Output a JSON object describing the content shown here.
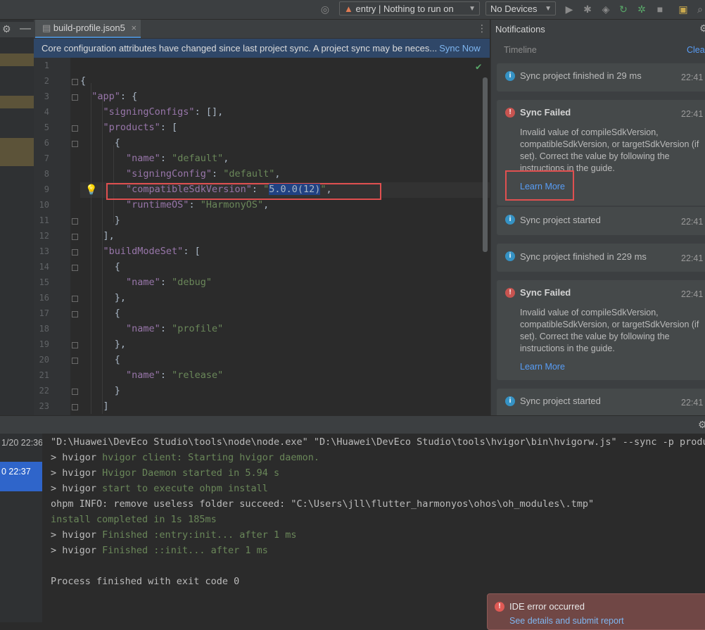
{
  "toolbar": {
    "run_config": "entry | Nothing to run on",
    "devices": "No Devices"
  },
  "editor": {
    "tab_label": "build-profile.json5",
    "tab_close": "×",
    "banner_text": "Core configuration attributes have changed since last project sync. A project sync may be neces...",
    "banner_link": "Sync Now",
    "lines": [
      {
        "n": "1",
        "parts": []
      },
      {
        "n": "2",
        "parts": [
          {
            "t": "{",
            "c": "p"
          }
        ]
      },
      {
        "n": "3",
        "parts": [
          {
            "t": "  ",
            "c": "p"
          },
          {
            "t": "\"app\"",
            "c": "k"
          },
          {
            "t": ": {",
            "c": "p"
          }
        ]
      },
      {
        "n": "4",
        "parts": [
          {
            "t": "    ",
            "c": "p"
          },
          {
            "t": "\"signingConfigs\"",
            "c": "k"
          },
          {
            "t": ": [],",
            "c": "p"
          }
        ]
      },
      {
        "n": "5",
        "parts": [
          {
            "t": "    ",
            "c": "p"
          },
          {
            "t": "\"products\"",
            "c": "k"
          },
          {
            "t": ": [",
            "c": "p"
          }
        ]
      },
      {
        "n": "6",
        "parts": [
          {
            "t": "      {",
            "c": "p"
          }
        ]
      },
      {
        "n": "7",
        "parts": [
          {
            "t": "        ",
            "c": "p"
          },
          {
            "t": "\"name\"",
            "c": "k"
          },
          {
            "t": ": ",
            "c": "p"
          },
          {
            "t": "\"default\"",
            "c": "s"
          },
          {
            "t": ",",
            "c": "p"
          }
        ]
      },
      {
        "n": "8",
        "parts": [
          {
            "t": "        ",
            "c": "p"
          },
          {
            "t": "\"signingConfig\"",
            "c": "k"
          },
          {
            "t": ": ",
            "c": "p"
          },
          {
            "t": "\"default\"",
            "c": "s"
          },
          {
            "t": ",",
            "c": "p"
          }
        ]
      },
      {
        "n": "9",
        "parts": [
          {
            "t": "        ",
            "c": "p"
          },
          {
            "t": "\"compatibleSdkVersion\"",
            "c": "k"
          },
          {
            "t": ": ",
            "c": "p"
          },
          {
            "t": "\"",
            "c": "s"
          },
          {
            "t": "5.0.0(12)",
            "c": "sel"
          },
          {
            "t": "\"",
            "c": "s"
          },
          {
            "t": ",",
            "c": "p"
          }
        ]
      },
      {
        "n": "10",
        "parts": [
          {
            "t": "        ",
            "c": "p"
          },
          {
            "t": "\"runtimeOS\"",
            "c": "k"
          },
          {
            "t": ": ",
            "c": "p"
          },
          {
            "t": "\"HarmonyOS\"",
            "c": "s"
          },
          {
            "t": ",",
            "c": "p"
          }
        ]
      },
      {
        "n": "11",
        "parts": [
          {
            "t": "      }",
            "c": "p"
          }
        ]
      },
      {
        "n": "12",
        "parts": [
          {
            "t": "    ],",
            "c": "p"
          }
        ]
      },
      {
        "n": "13",
        "parts": [
          {
            "t": "    ",
            "c": "p"
          },
          {
            "t": "\"buildModeSet\"",
            "c": "k"
          },
          {
            "t": ": [",
            "c": "p"
          }
        ]
      },
      {
        "n": "14",
        "parts": [
          {
            "t": "      {",
            "c": "p"
          }
        ]
      },
      {
        "n": "15",
        "parts": [
          {
            "t": "        ",
            "c": "p"
          },
          {
            "t": "\"name\"",
            "c": "k"
          },
          {
            "t": ": ",
            "c": "p"
          },
          {
            "t": "\"debug\"",
            "c": "s"
          }
        ]
      },
      {
        "n": "16",
        "parts": [
          {
            "t": "      },",
            "c": "p"
          }
        ]
      },
      {
        "n": "17",
        "parts": [
          {
            "t": "      {",
            "c": "p"
          }
        ]
      },
      {
        "n": "18",
        "parts": [
          {
            "t": "        ",
            "c": "p"
          },
          {
            "t": "\"name\"",
            "c": "k"
          },
          {
            "t": ": ",
            "c": "p"
          },
          {
            "t": "\"profile\"",
            "c": "s"
          }
        ]
      },
      {
        "n": "19",
        "parts": [
          {
            "t": "      },",
            "c": "p"
          }
        ]
      },
      {
        "n": "20",
        "parts": [
          {
            "t": "      {",
            "c": "p"
          }
        ]
      },
      {
        "n": "21",
        "parts": [
          {
            "t": "        ",
            "c": "p"
          },
          {
            "t": "\"name\"",
            "c": "k"
          },
          {
            "t": ": ",
            "c": "p"
          },
          {
            "t": "\"release\"",
            "c": "s"
          }
        ]
      },
      {
        "n": "22",
        "parts": [
          {
            "t": "      }",
            "c": "p"
          }
        ]
      },
      {
        "n": "23",
        "parts": [
          {
            "t": "    ]",
            "c": "p"
          }
        ]
      }
    ]
  },
  "notifications": {
    "title": "Notifications",
    "timeline_label": "Timeline",
    "clear_label": "Clear",
    "items": [
      {
        "kind": "info",
        "title": "Sync project finished in 29 ms",
        "time": "22:41"
      },
      {
        "kind": "error",
        "title": "Sync Failed",
        "time": "22:41",
        "body": "Invalid value of compileSdkVersion, compatibleSdkVersion, or targetSdkVersion (if set). Correct the value by following the instructions in the guide.",
        "link": "Learn More"
      },
      {
        "kind": "info",
        "title": "Sync project started",
        "time": "22:41"
      },
      {
        "kind": "info",
        "title": "Sync project finished in 229 ms",
        "time": "22:41"
      },
      {
        "kind": "error",
        "title": "Sync Failed",
        "time": "22:41",
        "body": "Invalid value of compileSdkVersion, compatibleSdkVersion, or targetSdkVersion (if set). Correct the value by following the instructions in the guide.",
        "link": "Learn More"
      },
      {
        "kind": "info",
        "title": "Sync project started",
        "time": "22:41"
      }
    ]
  },
  "run": {
    "history": [
      "1/20 22:36",
      "0 22:37"
    ],
    "lines": [
      {
        "t": "\"D:\\Huawei\\DevEco Studio\\tools\\node\\node.exe\" \"D:\\Huawei\\DevEco Studio\\tools\\hvigor\\bin\\hvigorw.js\" --sync -p product",
        "c": "w"
      },
      {
        "t": "> hvigor ",
        "c": "w",
        "g": "hvigor client: Starting hvigor daemon."
      },
      {
        "t": "> hvigor ",
        "c": "w",
        "g": "Hvigor Daemon started in 5.94 s"
      },
      {
        "t": "> hvigor ",
        "c": "w",
        "g": "start to execute ohpm install"
      },
      {
        "t": "ohpm INFO: remove useless folder succeed: \"C:\\Users\\jll\\flutter_harmonyos\\ohos\\oh_modules\\.tmp\"",
        "c": "w"
      },
      {
        "t": "",
        "c": "w",
        "g": "install completed in 1s 185ms"
      },
      {
        "t": "> hvigor ",
        "c": "w",
        "g": "Finished :entry:init... after 1 ms"
      },
      {
        "t": "> hvigor ",
        "c": "w",
        "g": "Finished ::init... after 1 ms"
      },
      {
        "t": "",
        "c": "w"
      },
      {
        "t": "Process finished with exit code 0",
        "c": "w"
      }
    ],
    "ide_error_title": "IDE error occurred",
    "ide_error_link": "See details and submit report"
  }
}
